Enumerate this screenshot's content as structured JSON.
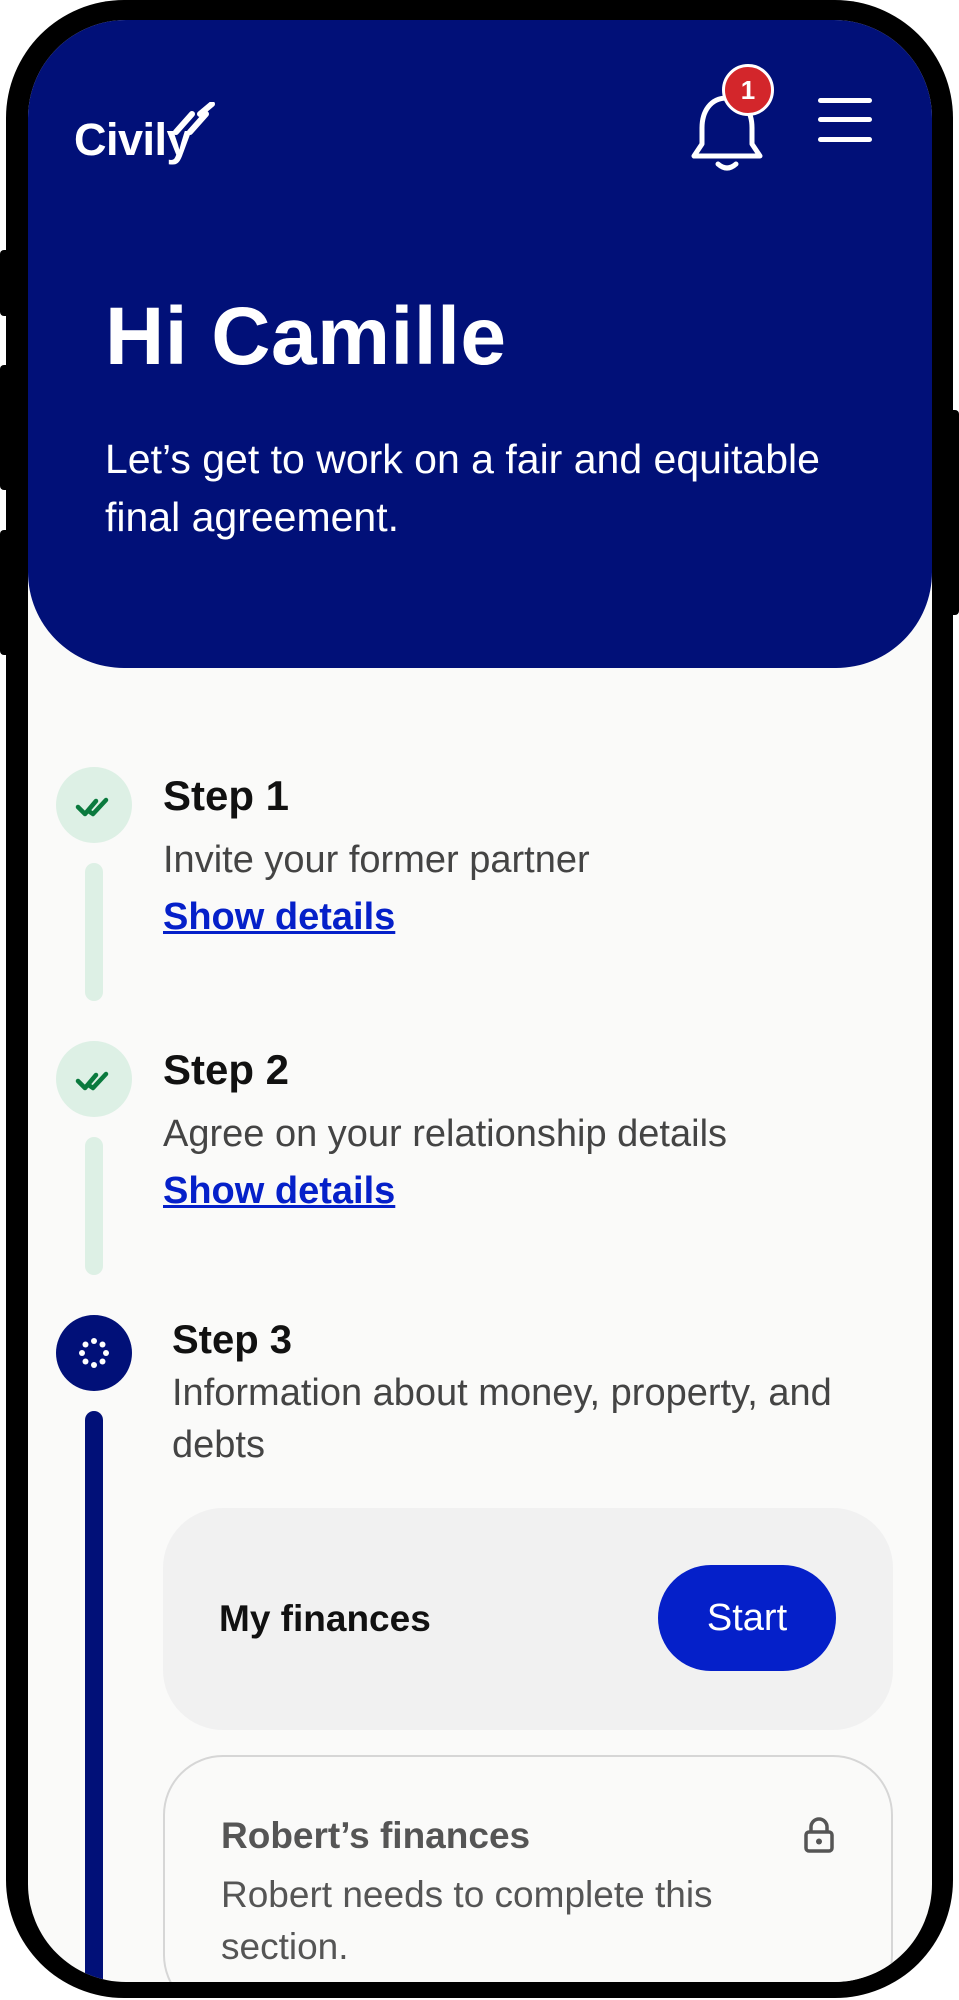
{
  "header": {
    "logo_text": "Civily",
    "notification_count": "1",
    "greeting": "Hi Camille",
    "subtitle": "Let’s get to work on a fair and equitable final agreement."
  },
  "steps": [
    {
      "title": "Step 1",
      "description": "Invite your former partner",
      "link": "Show details",
      "status": "complete"
    },
    {
      "title": "Step 2",
      "description": "Agree on your relationship details",
      "link": "Show details",
      "status": "complete"
    },
    {
      "title": "Step 3",
      "description": "Information about money, property, and debts",
      "status": "in-progress"
    }
  ],
  "sections": {
    "my_finances": {
      "label": "My finances",
      "button": "Start"
    },
    "partner_finances": {
      "label": "Robert’s finances",
      "description": "Robert needs to complete this section.",
      "locked": true
    }
  },
  "colors": {
    "primary": "#011078",
    "accent": "#0520c9",
    "done": "#ddf0e5",
    "done_check": "#0a7a3e",
    "badge": "#d3262b"
  },
  "icons": [
    "bell-icon",
    "menu-icon",
    "checkmark-icon",
    "progress-icon",
    "lock-icon"
  ]
}
